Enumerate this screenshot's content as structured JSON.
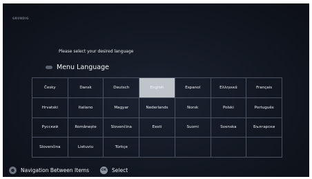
{
  "header": {
    "brand_text": "GRUNDIG",
    "prompt": "Please select your desired language"
  },
  "menu": {
    "icon": "language-icon",
    "title": "Menu Language",
    "selected": "English"
  },
  "languages": [
    [
      "Česky",
      "Dansk",
      "Deutsch",
      "English",
      "Espanol",
      "Ελληνικά",
      "Français"
    ],
    [
      "Hrvatski",
      "Italiano",
      "Magyar",
      "Nederlands",
      "Norsk",
      "Polski",
      "Português"
    ],
    [
      "Русский",
      "Românește",
      "Slovenčina",
      "Eesti",
      "Suomi",
      "Svenska",
      "Български"
    ],
    [
      "Slovenčina",
      "Lietuviu",
      "Türkçe",
      "",
      "",
      "",
      ""
    ]
  ],
  "footer": {
    "nav_icon": "navigation-pad-icon",
    "nav_label": "Navigation Between Items",
    "ok_icon_text": "OK",
    "ok_label": "Select"
  },
  "colors": {
    "background": "#121722",
    "grid_line": "#4a5262",
    "selected_cell": "#bfc3ca",
    "text": "#eef0f4"
  }
}
